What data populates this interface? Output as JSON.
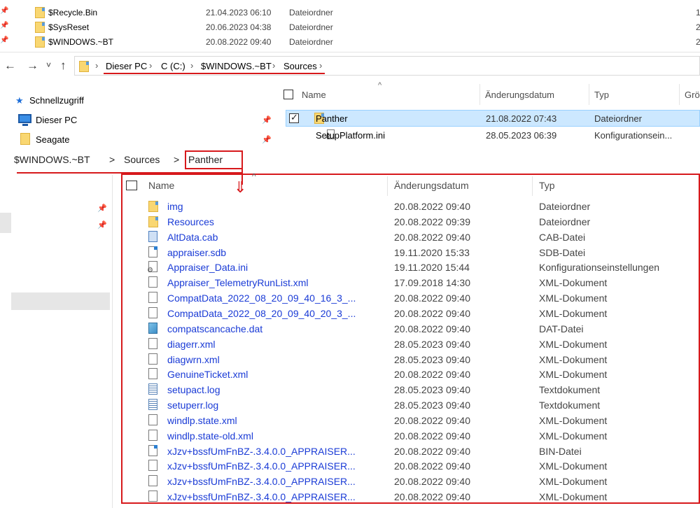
{
  "top_list": [
    {
      "name": "$Recycle.Bin",
      "date": "21.04.2023 06:10",
      "type": "Dateiordner",
      "size": "1"
    },
    {
      "name": "$SysReset",
      "date": "20.06.2023 04:38",
      "type": "Dateiordner",
      "size": "2"
    },
    {
      "name": "$WINDOWS.~BT",
      "date": "20.08.2022 09:40",
      "type": "Dateiordner",
      "size": "2"
    }
  ],
  "nav": {
    "back": "←",
    "forward": "→",
    "recent": "˅",
    "up": "↑"
  },
  "address": {
    "crumbs": [
      "Dieser PC",
      "C (C:)",
      "$WINDOWS.~BT",
      "Sources"
    ],
    "separator": "›"
  },
  "sidebar": {
    "items": [
      {
        "label": "Schnellzugriff",
        "icon": "star-icon"
      },
      {
        "label": "Dieser PC",
        "icon": "computer-icon"
      },
      {
        "label": "Seagate",
        "icon": "folder-icon"
      }
    ]
  },
  "pane1": {
    "headers": {
      "name": "Name",
      "date": "Änderungsdatum",
      "type": "Typ",
      "size": "Grö"
    },
    "rows": [
      {
        "name": "Panther",
        "date": "21.08.2022 07:43",
        "type": "Dateiordner",
        "selected": true
      },
      {
        "name": "SetupPlatform.ini",
        "date": "28.05.2023 06:39",
        "type": "Konfigurationsein..."
      }
    ]
  },
  "breadcrumb2": {
    "crumbs": [
      "$WINDOWS.~BT",
      "Sources",
      "Panther"
    ],
    "separator": ">"
  },
  "main_list": {
    "headers": {
      "name": "Name",
      "date": "Änderungsdatum",
      "type": "Typ"
    },
    "rows": [
      {
        "name": "img",
        "date": "20.08.2022 09:40",
        "type": "Dateiordner",
        "icon": "folder"
      },
      {
        "name": "Resources",
        "date": "20.08.2022 09:39",
        "type": "Dateiordner",
        "icon": "folder"
      },
      {
        "name": "AltData.cab",
        "date": "20.08.2022 09:40",
        "type": "CAB-Datei",
        "icon": "cab"
      },
      {
        "name": "appraiser.sdb",
        "date": "19.11.2020 15:33",
        "type": "SDB-Datei",
        "icon": "blue"
      },
      {
        "name": "Appraiser_Data.ini",
        "date": "19.11.2020 15:44",
        "type": "Konfigurationseinstellungen",
        "icon": "gear"
      },
      {
        "name": "Appraiser_TelemetryRunList.xml",
        "date": "17.09.2018 14:30",
        "type": "XML-Dokument",
        "icon": "plain"
      },
      {
        "name": "CompatData_2022_08_20_09_40_16_3_...",
        "date": "20.08.2022 09:40",
        "type": "XML-Dokument",
        "icon": "plain"
      },
      {
        "name": "CompatData_2022_08_20_09_40_20_3_...",
        "date": "20.08.2022 09:40",
        "type": "XML-Dokument",
        "icon": "plain"
      },
      {
        "name": "compatscancache.dat",
        "date": "20.08.2022 09:40",
        "type": "DAT-Datei",
        "icon": "dat"
      },
      {
        "name": "diagerr.xml",
        "date": "28.05.2023 09:40",
        "type": "XML-Dokument",
        "icon": "plain"
      },
      {
        "name": "diagwrn.xml",
        "date": "28.05.2023 09:40",
        "type": "XML-Dokument",
        "icon": "plain"
      },
      {
        "name": "GenuineTicket.xml",
        "date": "20.08.2022 09:40",
        "type": "XML-Dokument",
        "icon": "plain"
      },
      {
        "name": "setupact.log",
        "date": "28.05.2023 09:40",
        "type": "Textdokument",
        "icon": "lines"
      },
      {
        "name": "setuperr.log",
        "date": "28.05.2023 09:40",
        "type": "Textdokument",
        "icon": "lines"
      },
      {
        "name": "windlp.state.xml",
        "date": "20.08.2022 09:40",
        "type": "XML-Dokument",
        "icon": "plain"
      },
      {
        "name": "windlp.state-old.xml",
        "date": "20.08.2022 09:40",
        "type": "XML-Dokument",
        "icon": "plain"
      },
      {
        "name": "xJzv+bssfUmFnBZ-.3.4.0.0_APPRAISER...",
        "date": "20.08.2022 09:40",
        "type": "BIN-Datei",
        "icon": "blue"
      },
      {
        "name": "xJzv+bssfUmFnBZ-.3.4.0.0_APPRAISER...",
        "date": "20.08.2022 09:40",
        "type": "XML-Dokument",
        "icon": "plain"
      },
      {
        "name": "xJzv+bssfUmFnBZ-.3.4.0.0_APPRAISER...",
        "date": "20.08.2022 09:40",
        "type": "XML-Dokument",
        "icon": "plain"
      },
      {
        "name": "xJzv+bssfUmFnBZ-.3.4.0.0_APPRAISER...",
        "date": "20.08.2022 09:40",
        "type": "XML-Dokument",
        "icon": "plain"
      }
    ]
  },
  "annotation": {
    "arrow": "⇓",
    "accent": "#d7191c"
  }
}
